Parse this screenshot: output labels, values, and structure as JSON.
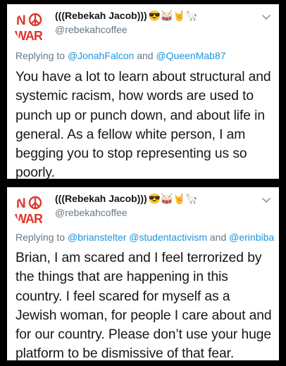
{
  "tweets": [
    {
      "author_name": "(((Rebekah Jacob)))",
      "author_emojis": "😎🥁🤘🦙",
      "handle": "@rebekahcoffee",
      "avatar": {
        "top_text": "NO",
        "bottom_text": "WAR",
        "symbol": "peace-sign",
        "color": "#e0362c"
      },
      "replying_prefix": "Replying to",
      "mentions": [
        "@JonahFalcon",
        "@QueenMab87"
      ],
      "mention_sep1": " and ",
      "mention_sep2": "",
      "text": "You have a lot to learn about structural and systemic racism, how words are used to punch up or punch down, and about life in general. As a fellow white person, I am begging you to stop representing us so poorly."
    },
    {
      "author_name": "(((Rebekah Jacob)))",
      "author_emojis": "😎🥁🤘🦙",
      "handle": "@rebekahcoffee",
      "avatar": {
        "top_text": "NO",
        "bottom_text": "WAR",
        "symbol": "peace-sign",
        "color": "#e0362c"
      },
      "replying_prefix": "Replying to",
      "mentions": [
        "@brianstelter",
        "@studentactivism",
        "@erinbiba"
      ],
      "mention_sep1": " ",
      "mention_sep2": " and ",
      "text": "Brian, I am scared and I feel terrorized by the things that are happening in this country. I feel scared for myself as a Jewish woman, for people I care about and for our country. Please don’t use your huge platform to be dismissive of that fear."
    }
  ],
  "icons": {
    "menu": "chevron-down-icon"
  }
}
